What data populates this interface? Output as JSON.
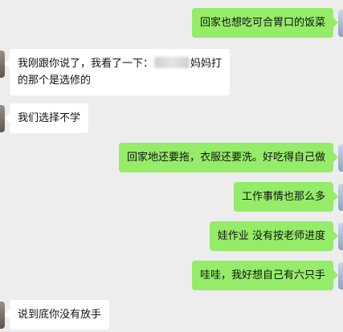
{
  "messages": [
    {
      "side": "right",
      "text": "回家也想吃可合胃口的饭菜"
    },
    {
      "side": "left",
      "line1_before": "我刚跟你说了，我看了一下：",
      "line1_after": "妈妈打",
      "line2": "的那个是选修的"
    },
    {
      "side": "left",
      "text": "我们选择不学"
    },
    {
      "side": "right",
      "text": "回家地还要拖，衣服还要洗。好吃得自己做"
    },
    {
      "side": "right",
      "text": "工作事情也那么多"
    },
    {
      "side": "right",
      "text": "娃作业 没有按老师进度"
    },
    {
      "side": "right",
      "text": "哇哇，我好想自己有六只手"
    },
    {
      "side": "left",
      "text": "说到底你没有放手"
    }
  ],
  "colors": {
    "background": "#ededed",
    "incoming_bubble": "#ffffff",
    "outgoing_bubble": "#95ec69"
  }
}
